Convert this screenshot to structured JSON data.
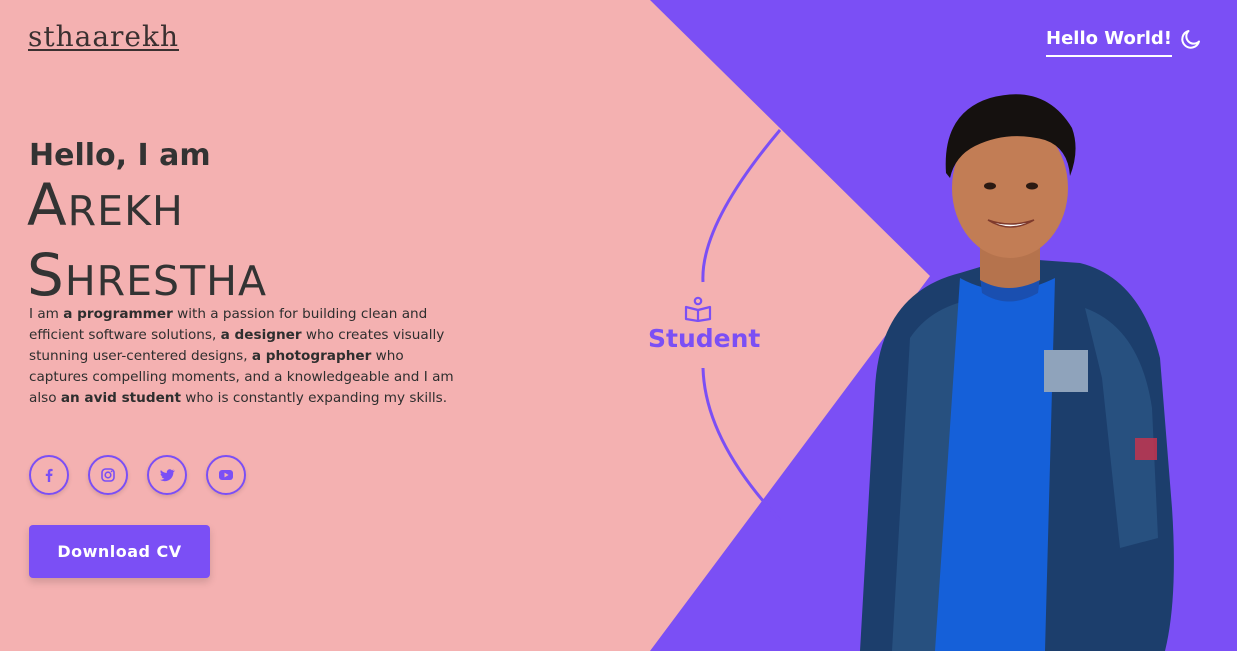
{
  "brand": {
    "logo_text": "sthaarekh"
  },
  "nav": {
    "link_label": "Hello World!",
    "theme_icon": "moon-icon"
  },
  "hero": {
    "greeting": "Hello, I am",
    "first_name": "Arekh",
    "last_name": "Shrestha",
    "bio": {
      "t1": "I am ",
      "b1": "a programmer",
      "t2": " with a passion for building clean and efficient software solutions, ",
      "b2": "a designer",
      "t3": " who creates visually stunning user-centered designs, ",
      "b3": "a photographer",
      "t4": " who captures compelling moments, and a knowledgeable and I am also ",
      "b4": "an avid student",
      "t5": " who is constantly expanding my skills."
    },
    "socials": [
      "facebook-icon",
      "instagram-icon",
      "twitter-icon",
      "youtube-icon"
    ],
    "cv_button": "Download CV"
  },
  "role": {
    "icon": "book-reader-icon",
    "label": "Student"
  },
  "colors": {
    "accent": "#7b4ff5",
    "background": "#f4b1b1",
    "text": "#2e2e2e"
  }
}
